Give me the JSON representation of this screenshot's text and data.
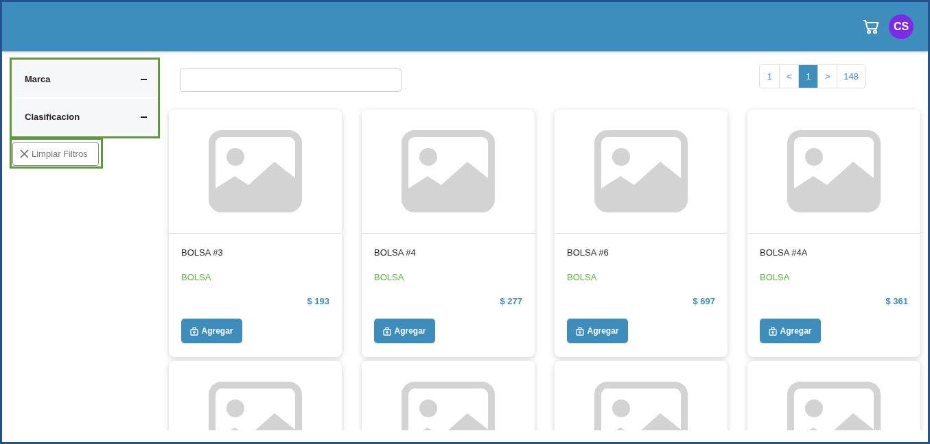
{
  "header": {
    "avatar": "CS"
  },
  "filters": [
    {
      "label": "Marca",
      "expanded": true
    },
    {
      "label": "Clasificacion",
      "expanded": true
    }
  ],
  "clear_button": "Limpiar Filtros",
  "pagination": [
    {
      "label": "1",
      "selected": false
    },
    {
      "label": "<",
      "selected": false
    },
    {
      "label": "1",
      "selected": true
    },
    {
      "label": ">",
      "selected": false
    },
    {
      "label": "148",
      "selected": false
    }
  ],
  "products": [
    {
      "kind": "product",
      "name": "BOLSA #3",
      "category": "BOLSA",
      "price": "$ 193",
      "button": "Agregar"
    },
    {
      "kind": "product",
      "name": "BOLSA #4",
      "category": "BOLSA",
      "price": "$ 277",
      "button": "Agregar"
    },
    {
      "kind": "product",
      "name": "BOLSA #6",
      "category": "BOLSA",
      "price": "$ 697",
      "button": "Agregar"
    },
    {
      "kind": "product",
      "name": "BOLSA #4A",
      "category": "BOLSA",
      "price": "$ 361",
      "button": "Agregar"
    },
    {
      "kind": "image-only"
    },
    {
      "kind": "image-only"
    },
    {
      "kind": "image-only"
    },
    {
      "kind": "image-only"
    }
  ]
}
